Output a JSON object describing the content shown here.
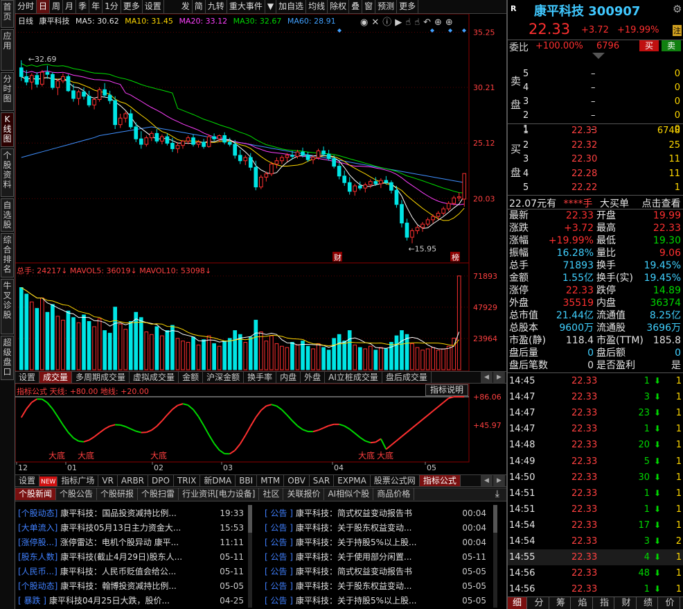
{
  "left_tabs": [
    "首页",
    "应用",
    "分时图",
    "K线图",
    "个股资料",
    "自选股",
    "综合排名",
    "牛叉诊股",
    "超级盘口"
  ],
  "top_toolbar": [
    "分时",
    "日",
    "周",
    "月",
    "季",
    "年",
    "1分",
    "更多",
    "设置",
    "发",
    "简",
    "九转",
    "重大事件",
    "加自选",
    "均线",
    "除权",
    "叠",
    "窗",
    "预测",
    "更多"
  ],
  "legend": {
    "period": "日线",
    "name": "康平科技",
    "ma5": "MA5: 30.62",
    "ma10": "MA10: 31.45",
    "ma20": "MA20: 33.12",
    "ma30": "MA30: 32.67",
    "ma60": "MA60: 28.91"
  },
  "annotations": {
    "high": "32.69",
    "low": "15.95",
    "cai": "财",
    "bang": "榜"
  },
  "colors": {
    "up": "#ff3030",
    "down": "#00e5e5",
    "ma5": "#ffffff",
    "ma10": "#ffd800",
    "ma20": "#ff40ff",
    "ma30": "#00e000",
    "ma60": "#4090ff"
  },
  "chart_data": [
    {
      "type": "candlestick",
      "title": "日线",
      "y_ticks": [
        "35.25",
        "30.21",
        "25.12",
        "20.03"
      ],
      "ylim": [
        14.6,
        36.3
      ],
      "series": [
        {
          "name": "K",
          "ohlc": [
            [
              32.0,
              32.69,
              30.8,
              31.2
            ],
            [
              31.2,
              31.8,
              30.4,
              30.7
            ],
            [
              30.7,
              31.5,
              30.0,
              31.3
            ],
            [
              31.3,
              31.6,
              30.2,
              30.5
            ],
            [
              30.5,
              31.8,
              30.3,
              31.6
            ],
            [
              31.6,
              32.2,
              31.0,
              31.4
            ],
            [
              31.4,
              31.6,
              30.0,
              30.2
            ],
            [
              30.2,
              31.0,
              29.5,
              30.8
            ],
            [
              30.8,
              31.5,
              30.6,
              31.2
            ],
            [
              31.2,
              31.4,
              29.8,
              29.9
            ],
            [
              29.9,
              30.5,
              28.9,
              29.2
            ],
            [
              29.2,
              30.0,
              28.6,
              29.8
            ],
            [
              29.8,
              30.2,
              29.1,
              29.4
            ],
            [
              29.4,
              29.9,
              28.4,
              28.6
            ],
            [
              28.6,
              29.3,
              28.2,
              29.1
            ],
            [
              29.1,
              30.2,
              28.9,
              30.0
            ],
            [
              30.0,
              30.6,
              29.3,
              29.5
            ],
            [
              29.5,
              29.9,
              28.7,
              29.0
            ],
            [
              29.0,
              29.4,
              26.4,
              26.8
            ],
            [
              26.8,
              27.8,
              26.5,
              27.4
            ],
            [
              27.4,
              28.0,
              27.0,
              27.8
            ],
            [
              27.8,
              28.2,
              26.4,
              26.6
            ],
            [
              26.6,
              27.0,
              25.2,
              25.5
            ],
            [
              25.5,
              26.2,
              24.6,
              25.0
            ],
            [
              25.0,
              25.8,
              24.8,
              25.6
            ],
            [
              25.6,
              26.2,
              25.3,
              26.0
            ],
            [
              26.0,
              26.4,
              25.1,
              25.3
            ],
            [
              25.3,
              25.9,
              25.0,
              25.7
            ],
            [
              25.7,
              26.0,
              24.9,
              25.1
            ],
            [
              25.1,
              25.6,
              24.3,
              24.6
            ],
            [
              24.6,
              25.2,
              24.2,
              24.9
            ],
            [
              24.9,
              25.4,
              24.6,
              25.3
            ],
            [
              25.3,
              25.8,
              25.0,
              25.6
            ],
            [
              25.6,
              25.9,
              24.8,
              25.0
            ],
            [
              25.0,
              25.4,
              24.7,
              25.2
            ],
            [
              25.2,
              25.5,
              24.6,
              24.8
            ],
            [
              24.8,
              25.9,
              24.7,
              25.7
            ],
            [
              25.7,
              26.0,
              25.3,
              25.5
            ],
            [
              25.5,
              25.9,
              25.2,
              25.8
            ],
            [
              25.8,
              26.1,
              25.0,
              25.2
            ],
            [
              25.2,
              25.6,
              24.8,
              25.0
            ],
            [
              25.0,
              25.4,
              23.7,
              24.0
            ],
            [
              24.0,
              24.5,
              23.2,
              23.5
            ],
            [
              23.5,
              24.0,
              23.1,
              23.8
            ],
            [
              23.8,
              24.2,
              22.6,
              22.9
            ],
            [
              22.9,
              23.5,
              20.8,
              21.1
            ],
            [
              21.1,
              22.2,
              20.9,
              22.0
            ],
            [
              22.0,
              22.5,
              21.6,
              22.3
            ],
            [
              22.3,
              23.4,
              22.1,
              23.2
            ],
            [
              23.2,
              23.8,
              22.8,
              23.5
            ],
            [
              23.5,
              24.0,
              23.2,
              23.8
            ],
            [
              23.8,
              24.2,
              23.4,
              24.0
            ],
            [
              24.0,
              24.4,
              23.6,
              23.9
            ],
            [
              23.9,
              24.5,
              23.7,
              24.3
            ],
            [
              24.3,
              24.7,
              23.8,
              24.0
            ],
            [
              24.0,
              24.3,
              23.4,
              23.6
            ],
            [
              23.6,
              24.0,
              23.2,
              23.8
            ],
            [
              23.8,
              24.6,
              23.6,
              24.4
            ],
            [
              24.4,
              24.8,
              23.9,
              24.1
            ],
            [
              24.1,
              24.5,
              23.5,
              23.7
            ],
            [
              23.7,
              24.0,
              22.8,
              23.0
            ],
            [
              23.0,
              23.3,
              21.8,
              22.1
            ],
            [
              22.1,
              22.6,
              21.2,
              21.5
            ],
            [
              21.5,
              22.0,
              20.4,
              20.7
            ],
            [
              20.7,
              21.4,
              20.3,
              21.2
            ],
            [
              21.2,
              21.6,
              20.8,
              21.0
            ],
            [
              21.0,
              21.5,
              20.6,
              21.3
            ],
            [
              21.3,
              21.8,
              21.0,
              21.6
            ],
            [
              21.6,
              22.0,
              21.2,
              21.4
            ],
            [
              21.4,
              21.9,
              21.0,
              21.7
            ],
            [
              21.7,
              22.1,
              21.3,
              21.5
            ],
            [
              21.5,
              21.7,
              20.5,
              20.8
            ],
            [
              20.8,
              21.2,
              19.2,
              19.5
            ],
            [
              19.5,
              19.9,
              17.4,
              17.8
            ],
            [
              17.8,
              18.2,
              16.2,
              16.5
            ],
            [
              16.5,
              17.3,
              15.95,
              17.1
            ],
            [
              17.1,
              17.6,
              16.8,
              17.4
            ],
            [
              17.4,
              17.9,
              17.0,
              17.7
            ],
            [
              17.7,
              18.3,
              17.5,
              18.1
            ],
            [
              18.1,
              18.6,
              17.8,
              18.4
            ],
            [
              18.4,
              18.9,
              18.1,
              18.7
            ],
            [
              18.7,
              19.3,
              18.5,
              19.1
            ],
            [
              19.1,
              19.8,
              18.9,
              19.6
            ],
            [
              19.6,
              20.3,
              19.4,
              20.1
            ],
            [
              20.1,
              20.6,
              19.8,
              20.2
            ],
            [
              19.99,
              22.33,
              19.3,
              22.33
            ]
          ]
        }
      ]
    },
    {
      "type": "bar",
      "title": "总手",
      "values": [
        63000,
        58000,
        52000,
        47000,
        55000,
        44000,
        50000,
        41000,
        38000,
        45000,
        40000,
        36000,
        42000,
        37000,
        33000,
        39000,
        30000,
        28000,
        48000,
        35000,
        31000,
        37000,
        44000,
        40000,
        29000,
        27000,
        33000,
        26000,
        30000,
        34000,
        24000,
        22000,
        21000,
        25000,
        19000,
        23000,
        26000,
        20000,
        18000,
        22000,
        24000,
        30000,
        27000,
        21000,
        25000,
        38000,
        29000,
        22000,
        26000,
        20000,
        18000,
        17000,
        21000,
        19000,
        22000,
        18000,
        16000,
        20000,
        17000,
        15000,
        24000,
        27000,
        22000,
        30000,
        19000,
        17000,
        16000,
        18000,
        15000,
        17000,
        16000,
        21000,
        26000,
        30000,
        27000,
        20000,
        17000,
        15000,
        16000,
        17000,
        15000,
        16000,
        18000,
        24217,
        71893
      ],
      "colors_up_down": "up/down",
      "y_ticks": [
        "71893",
        "47929",
        "23964"
      ],
      "legend": "总手: 24217↓ MAVOL5: 36019↓ MAVOL10: 53098↓",
      "ylim": [
        0,
        75000
      ]
    },
    {
      "type": "line",
      "title": "指标公式",
      "legend": "指标公式 天线: +80.00 地线: +20.00",
      "y_ticks": [
        "+86.06",
        "+45.97"
      ],
      "x": [
        "12",
        "01",
        "02",
        "03",
        "04",
        "05"
      ],
      "annotations": [
        "大底",
        "大底",
        "大底",
        "大底",
        "大底"
      ]
    }
  ],
  "volume_tabs": [
    "设置",
    "成交量",
    "多周期成交量",
    "虚拟成交量",
    "金额",
    "沪深金额",
    "换手率",
    "内盘",
    "外盘",
    "AI立桩成交量",
    "盘后成交量"
  ],
  "indicator_label": "指标说明",
  "indicator_tabs": [
    "设置",
    "NEW",
    "指标广场",
    "VR",
    "ARBR",
    "DPO",
    "TRIX",
    "新DMA",
    "BBI",
    "MTM",
    "OBV",
    "SAR",
    "EXPMA",
    "股票公式网",
    "指标公式"
  ],
  "news_tabs": [
    "个股新闻",
    "个股公告",
    "个股研报",
    "个股扫雷",
    "行业资讯[电力设备]",
    "社区",
    "关联报价",
    "AI相似个股",
    "商品价格"
  ],
  "news_left": [
    {
      "tag": "[个股动态]",
      "title": "康平科技：国品投资减持比例...",
      "time": "19:33"
    },
    {
      "tag": "[大单流入]",
      "title": "康平科技05月13日主力资金大...",
      "time": "15:53"
    },
    {
      "tag": "[涨停股...]",
      "title": "涨停雷达：电机个股异动 康平...",
      "time": "11:11"
    },
    {
      "tag": "[股东人数]",
      "title": "康平科技(截止4月29日)股东人...",
      "time": "05-11"
    },
    {
      "tag": "[人民币...]",
      "title": "康平科技：人民币贬值会给公...",
      "time": "05-11"
    },
    {
      "tag": "[个股动态]",
      "title": "康平科技：翰博投资减持比例...",
      "time": "05-05"
    },
    {
      "tag": "[ 暴跌 ]",
      "title": "康平科技04月25日大跌，股价...",
      "time": "04-25"
    }
  ],
  "news_right": [
    {
      "tag": "[ 公告 ]",
      "title": "康平科技：简式权益变动报告书",
      "time": "00:04"
    },
    {
      "tag": "[ 公告 ]",
      "title": "康平科技：关于股东权益变动...",
      "time": "00:04"
    },
    {
      "tag": "[ 公告 ]",
      "title": "康平科技：关于持股5%以上股...",
      "time": "00:04"
    },
    {
      "tag": "[ 公告 ]",
      "title": "康平科技：关于使用部分闲置...",
      "time": "05-11"
    },
    {
      "tag": "[ 公告 ]",
      "title": "康平科技：简式权益变动报告书",
      "time": "05-05"
    },
    {
      "tag": "[ 公告 ]",
      "title": "康平科技：关于股东权益变动...",
      "time": "05-05"
    },
    {
      "tag": "[ 公告 ]",
      "title": "康平科技：关于持股5%以上股...",
      "time": "05-05"
    }
  ],
  "stock": {
    "r": "R",
    "name": "康平科技 300907",
    "price": "22.33",
    "change": "+3.72",
    "pct": "+19.99%",
    "zhu": "注"
  },
  "weibi": {
    "label": "委比",
    "pct": "+100.00%",
    "val": "6796",
    "buy": "买",
    "sell": "卖"
  },
  "sell_book": [
    {
      "n": "5",
      "p": "–",
      "v": "0"
    },
    {
      "n": "4",
      "p": "–",
      "v": "0"
    },
    {
      "n": "3",
      "p": "–",
      "v": "0"
    },
    {
      "n": "2",
      "p": "–",
      "v": "0"
    },
    {
      "n": "1",
      "p": "–",
      "v": "0"
    }
  ],
  "buy_book": [
    {
      "n": "1",
      "p": "22.33",
      "v": "6748"
    },
    {
      "n": "2",
      "p": "22.32",
      "v": "25"
    },
    {
      "n": "3",
      "p": "22.30",
      "v": "11"
    },
    {
      "n": "4",
      "p": "22.28",
      "v": "11"
    },
    {
      "n": "5",
      "p": "22.22",
      "v": "1"
    }
  ],
  "book_side": {
    "sell": [
      "卖",
      "盘"
    ],
    "buy": [
      "买",
      "盘"
    ]
  },
  "bigorder": {
    "a": "22.07元有",
    "b": "****手",
    "c": "大买单",
    "d": "点击查看"
  },
  "stats": [
    [
      "最新",
      "22.33",
      "开盘",
      "19.99"
    ],
    [
      "涨跌",
      "+3.72",
      "最高",
      "22.33"
    ],
    [
      "涨幅",
      "+19.99%",
      "最低",
      "19.30"
    ],
    [
      "振幅",
      "16.28%",
      "量比",
      "9.06"
    ],
    [
      "总手",
      "71893",
      "换手",
      "19.45%"
    ],
    [
      "金额",
      "1.55亿",
      "换手(实)",
      "19.45%"
    ],
    [
      "涨停",
      "22.33",
      "跌停",
      "14.89"
    ],
    [
      "外盘",
      "35519",
      "内盘",
      "36374"
    ],
    [
      "总市值",
      "21.44亿",
      "流通值",
      "8.25亿"
    ],
    [
      "总股本",
      "9600万",
      "流通股",
      "3696万"
    ],
    [
      "市盈(静)",
      "118.4",
      "市盈(TTM)",
      "185.8"
    ],
    [
      "盘后量",
      "0",
      "盘后额",
      "0"
    ],
    [
      "盘后笔数",
      "0",
      "是否盈利",
      "是"
    ]
  ],
  "ticks": [
    {
      "t": "14:45",
      "p": "22.33",
      "v": "1",
      "n": "1"
    },
    {
      "t": "14:47",
      "p": "22.33",
      "v": "3",
      "n": "1"
    },
    {
      "t": "14:47",
      "p": "22.33",
      "v": "23",
      "n": "1"
    },
    {
      "t": "14:47",
      "p": "22.33",
      "v": "1",
      "n": "1"
    },
    {
      "t": "14:48",
      "p": "22.33",
      "v": "20",
      "n": "1"
    },
    {
      "t": "14:49",
      "p": "22.33",
      "v": "5",
      "n": "1"
    },
    {
      "t": "14:50",
      "p": "22.33",
      "v": "30",
      "n": "1"
    },
    {
      "t": "14:51",
      "p": "22.33",
      "v": "1",
      "n": "1"
    },
    {
      "t": "14:51",
      "p": "22.33",
      "v": "1",
      "n": "1"
    },
    {
      "t": "14:54",
      "p": "22.33",
      "v": "17",
      "n": "1"
    },
    {
      "t": "14:54",
      "p": "22.33",
      "v": "3",
      "n": "2"
    },
    {
      "t": "14:55",
      "p": "22.33",
      "v": "4",
      "n": "1"
    },
    {
      "t": "14:56",
      "p": "22.33",
      "v": "48",
      "n": "1"
    },
    {
      "t": "14:56",
      "p": "22.33",
      "v": "1",
      "n": "1"
    }
  ],
  "bottom_tabs": [
    "细",
    "分",
    "筹",
    "焰",
    "指",
    "财",
    "绩",
    "价"
  ]
}
